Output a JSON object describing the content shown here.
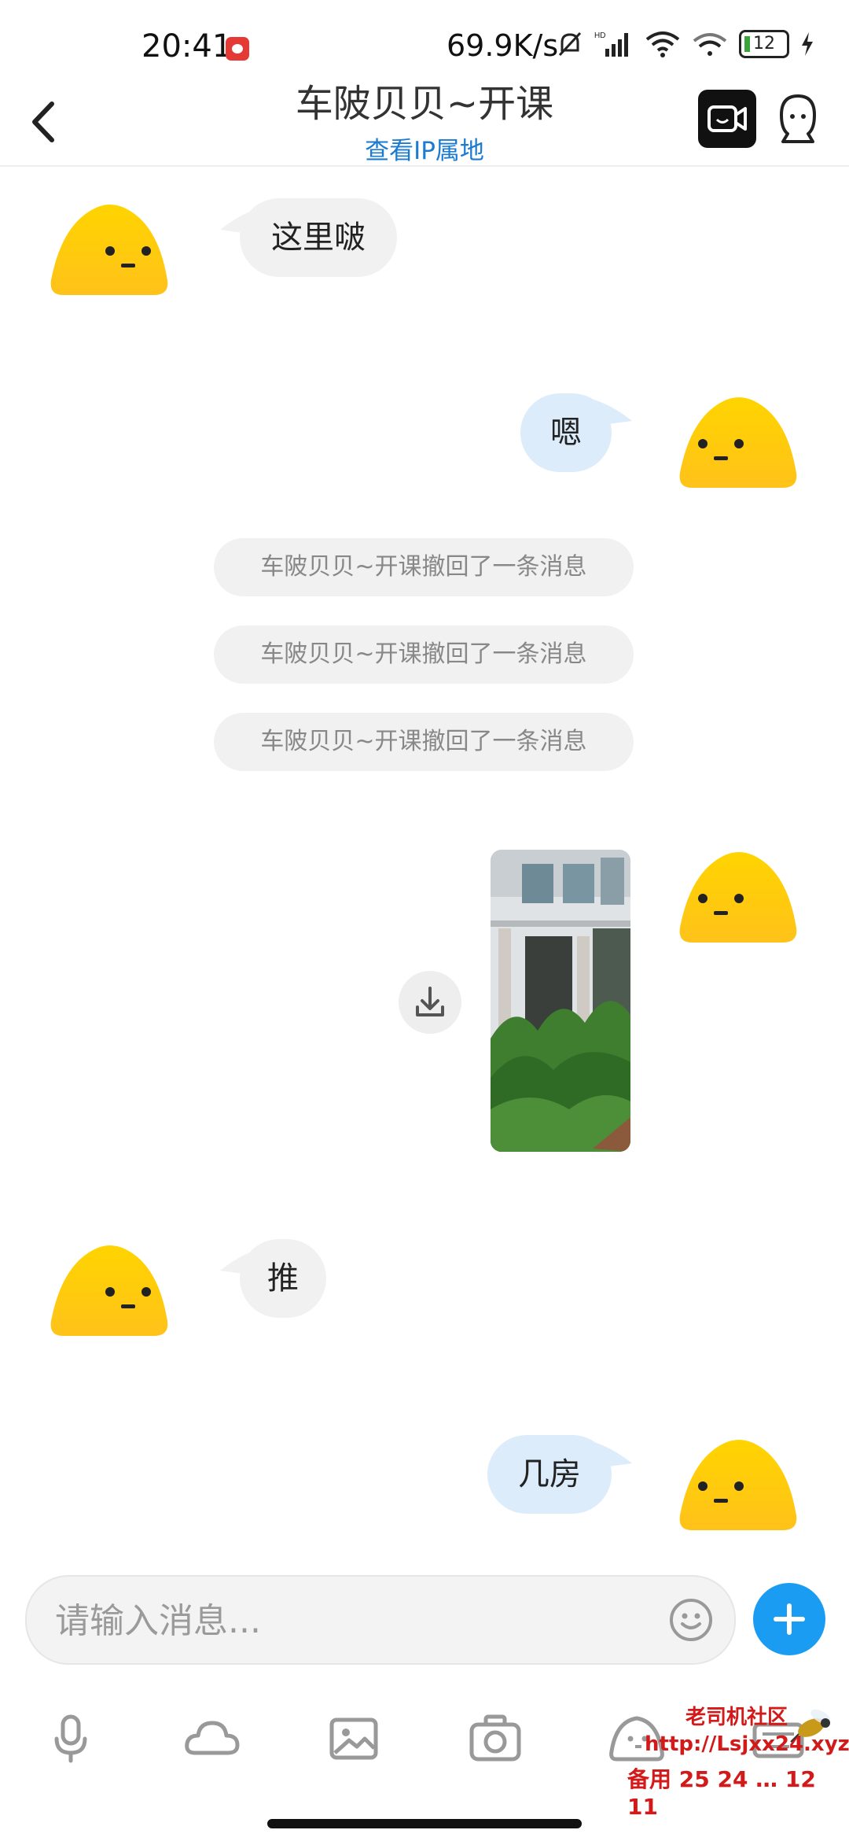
{
  "status_bar": {
    "time": "20:41",
    "net_speed": "69.9K/s",
    "battery": "12",
    "icons": [
      "record-icon",
      "mute-bell-icon",
      "hd-signal-icon",
      "wifi-icon",
      "hotspot-icon",
      "battery-icon",
      "charging-icon"
    ]
  },
  "header": {
    "title": "车陂贝贝~开课",
    "subtitle": "查看IP属地"
  },
  "messages": [
    {
      "side": "in",
      "text": "这里啵"
    },
    {
      "side": "out",
      "text": "嗯"
    },
    {
      "type": "system",
      "text": "车陂贝贝~开课撤回了一条消息"
    },
    {
      "type": "system",
      "text": "车陂贝贝~开课撤回了一条消息"
    },
    {
      "type": "system",
      "text": "车陂贝贝~开课撤回了一条消息"
    },
    {
      "side": "out",
      "type": "image"
    },
    {
      "side": "in",
      "text": "推"
    },
    {
      "side": "out",
      "text": "几房"
    }
  ],
  "input": {
    "placeholder": "请输入消息..."
  },
  "toolbar": [
    "microphone-icon",
    "cloud-icon",
    "image-icon",
    "camera-icon",
    "emoji-icon",
    "keyboard-icon"
  ],
  "watermark": {
    "line1": "老司机社区",
    "line2": "http://Lsjxx24.xyz",
    "line3": "备用 25 24 … 12 11"
  },
  "colors": {
    "accent": "#1a9cf3",
    "link": "#1a7bd0",
    "out_bubble": "#dcecfb",
    "in_bubble": "#f1f1f1",
    "avatar_top": "#ffd400",
    "avatar_bottom": "#ffc21a"
  }
}
